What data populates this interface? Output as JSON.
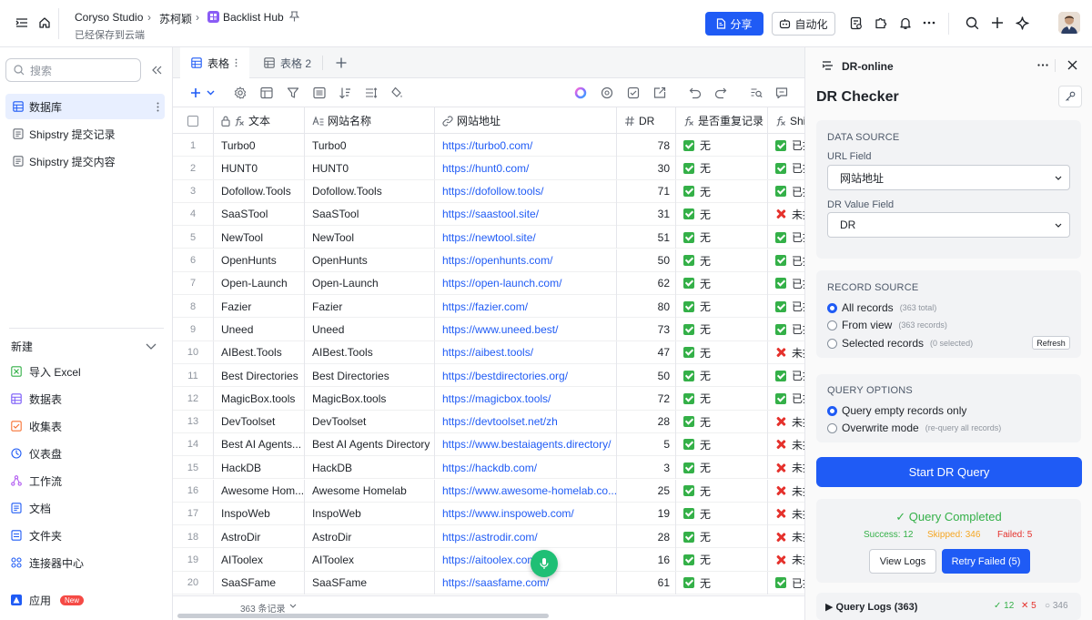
{
  "topbar": {
    "breadcrumb_org": "Coryso Studio",
    "breadcrumb_user": "苏柯颖",
    "breadcrumb_base": "Backlist Hub",
    "saved_status": "已经保存到云端",
    "share_label": "分享",
    "automation_label": "自动化"
  },
  "sidebar": {
    "search_placeholder": "搜索",
    "items": [
      {
        "label": "数据库",
        "active": true
      },
      {
        "label": "Shipstry 提交记录"
      },
      {
        "label": "Shipstry 提交内容"
      }
    ],
    "new_section_label": "新建",
    "new_items": [
      {
        "label": "导入 Excel",
        "color": "#34b048",
        "icon": "excel-icon"
      },
      {
        "label": "数据表",
        "color": "#7a5af8",
        "icon": "table-icon"
      },
      {
        "label": "收集表",
        "color": "#f77234",
        "icon": "form-icon"
      },
      {
        "label": "仪表盘",
        "color": "#1f5bf5",
        "icon": "dashboard-icon"
      },
      {
        "label": "工作流",
        "color": "#b15bf1",
        "icon": "workflow-icon"
      },
      {
        "label": "文档",
        "color": "#1f5bf5",
        "icon": "doc-icon"
      },
      {
        "label": "文件夹",
        "color": "#1f5bf5",
        "icon": "folder-icon"
      },
      {
        "label": "连接器中心",
        "color": "#1f5bf5",
        "icon": "connector-icon"
      },
      {
        "label": "应用",
        "color": "#1f5bf5",
        "icon": "app-icon"
      }
    ],
    "app_badge": "New"
  },
  "tabs": [
    {
      "label": "表格",
      "active": true
    },
    {
      "label": "表格 2",
      "active": false
    }
  ],
  "grid": {
    "columns": [
      "文本",
      "网站名称",
      "网站地址",
      "DR",
      "是否重复记录",
      "Ship"
    ],
    "rows": [
      {
        "n": "1",
        "text": "Turbo0",
        "name": "Turbo0",
        "url": "https://turbo0.com/",
        "dr": "78",
        "dup": "无",
        "ship_ok": true,
        "ship": "已提"
      },
      {
        "n": "2",
        "text": "HUNT0",
        "name": "HUNT0",
        "url": "https://hunt0.com/",
        "dr": "30",
        "dup": "无",
        "ship_ok": true,
        "ship": "已提"
      },
      {
        "n": "3",
        "text": "Dofollow.Tools",
        "name": "Dofollow.Tools",
        "url": "https://dofollow.tools/",
        "dr": "71",
        "dup": "无",
        "ship_ok": true,
        "ship": "已提"
      },
      {
        "n": "4",
        "text": "SaaSTool",
        "name": "SaaSTool",
        "url": "https://saastool.site/",
        "dr": "31",
        "dup": "无",
        "ship_ok": false,
        "ship": "未提"
      },
      {
        "n": "5",
        "text": "NewTool",
        "name": "NewTool",
        "url": "https://newtool.site/",
        "dr": "51",
        "dup": "无",
        "ship_ok": true,
        "ship": "已提"
      },
      {
        "n": "6",
        "text": "OpenHunts",
        "name": "OpenHunts",
        "url": "https://openhunts.com/",
        "dr": "50",
        "dup": "无",
        "ship_ok": true,
        "ship": "已提"
      },
      {
        "n": "7",
        "text": "Open-Launch",
        "name": "Open-Launch",
        "url": "https://open-launch.com/",
        "dr": "62",
        "dup": "无",
        "ship_ok": true,
        "ship": "已提"
      },
      {
        "n": "8",
        "text": "Fazier",
        "name": "Fazier",
        "url": "https://fazier.com/",
        "dr": "80",
        "dup": "无",
        "ship_ok": true,
        "ship": "已提"
      },
      {
        "n": "9",
        "text": "Uneed",
        "name": "Uneed",
        "url": "https://www.uneed.best/",
        "dr": "73",
        "dup": "无",
        "ship_ok": true,
        "ship": "已提"
      },
      {
        "n": "10",
        "text": "AIBest.Tools",
        "name": "AIBest.Tools",
        "url": "https://aibest.tools/",
        "dr": "47",
        "dup": "无",
        "ship_ok": false,
        "ship": "未提"
      },
      {
        "n": "11",
        "text": "Best Directories",
        "name": "Best Directories",
        "url": "https://bestdirectories.org/",
        "dr": "50",
        "dup": "无",
        "ship_ok": true,
        "ship": "已提"
      },
      {
        "n": "12",
        "text": "MagicBox.tools",
        "name": "MagicBox.tools",
        "url": "https://magicbox.tools/",
        "dr": "72",
        "dup": "无",
        "ship_ok": true,
        "ship": "已提"
      },
      {
        "n": "13",
        "text": "DevToolset",
        "name": "DevToolset",
        "url": "https://devtoolset.net/zh",
        "dr": "28",
        "dup": "无",
        "ship_ok": false,
        "ship": "未提"
      },
      {
        "n": "14",
        "text": "Best AI Agents...",
        "name": "Best AI Agents Directory",
        "url": "https://www.bestaiagents.directory/",
        "dr": "5",
        "dup": "无",
        "ship_ok": false,
        "ship": "未提"
      },
      {
        "n": "15",
        "text": "HackDB",
        "name": "HackDB",
        "url": "https://hackdb.com/",
        "dr": "3",
        "dup": "无",
        "ship_ok": false,
        "ship": "未提"
      },
      {
        "n": "16",
        "text": "Awesome Hom...",
        "name": "Awesome Homelab",
        "url": "https://www.awesome-homelab.co...",
        "dr": "25",
        "dup": "无",
        "ship_ok": false,
        "ship": "未提"
      },
      {
        "n": "17",
        "text": "InspoWeb",
        "name": "InspoWeb",
        "url": "https://www.inspoweb.com/",
        "dr": "19",
        "dup": "无",
        "ship_ok": false,
        "ship": "未提"
      },
      {
        "n": "18",
        "text": "AstroDir",
        "name": "AstroDir",
        "url": "https://astrodir.com/",
        "dr": "28",
        "dup": "无",
        "ship_ok": false,
        "ship": "未提"
      },
      {
        "n": "19",
        "text": "AIToolex",
        "name": "AIToolex",
        "url": "https://aitoolex.com/",
        "dr": "16",
        "dup": "无",
        "ship_ok": false,
        "ship": "未提"
      },
      {
        "n": "20",
        "text": "SaaSFame",
        "name": "SaaSFame",
        "url": "https://saasfame.com/",
        "dr": "61",
        "dup": "无",
        "ship_ok": true,
        "ship": "已提"
      }
    ],
    "record_count": "363 条记录"
  },
  "panel": {
    "plugin_name": "DR-online",
    "title": "DR Checker",
    "data_source_title": "DATA SOURCE",
    "url_field_label": "URL Field",
    "url_field_value": "网站地址",
    "dr_field_label": "DR Value Field",
    "dr_field_value": "DR",
    "record_source_title": "RECORD SOURCE",
    "record_options": [
      {
        "label": "All records",
        "hint": "(363 total)",
        "selected": true
      },
      {
        "label": "From view",
        "hint": "(363 records)",
        "selected": false
      },
      {
        "label": "Selected records",
        "hint": "(0 selected)",
        "selected": false
      }
    ],
    "refresh_label": "Refresh",
    "query_options_title": "QUERY OPTIONS",
    "query_options": [
      {
        "label": "Query empty records only",
        "hint": "",
        "selected": true
      },
      {
        "label": "Overwrite mode",
        "hint": "(re-query all records)",
        "selected": false
      }
    ],
    "start_label": "Start DR Query",
    "completed_label": "✓ Query Completed",
    "success_label": "Success: 12",
    "skipped_label": "Skipped: 346",
    "failed_label": "Failed: 5",
    "view_logs_label": "View Logs",
    "retry_label": "Retry Failed (5)",
    "logs_title": "▶ Query Logs (363)",
    "logs_ok": "✓ 12",
    "logs_fail": "✕ 5",
    "logs_skip": "○ 346",
    "colors": {
      "accent": "#1f5bf5",
      "success": "#34b048",
      "warning": "#f5a623",
      "error": "#e5312c"
    }
  }
}
